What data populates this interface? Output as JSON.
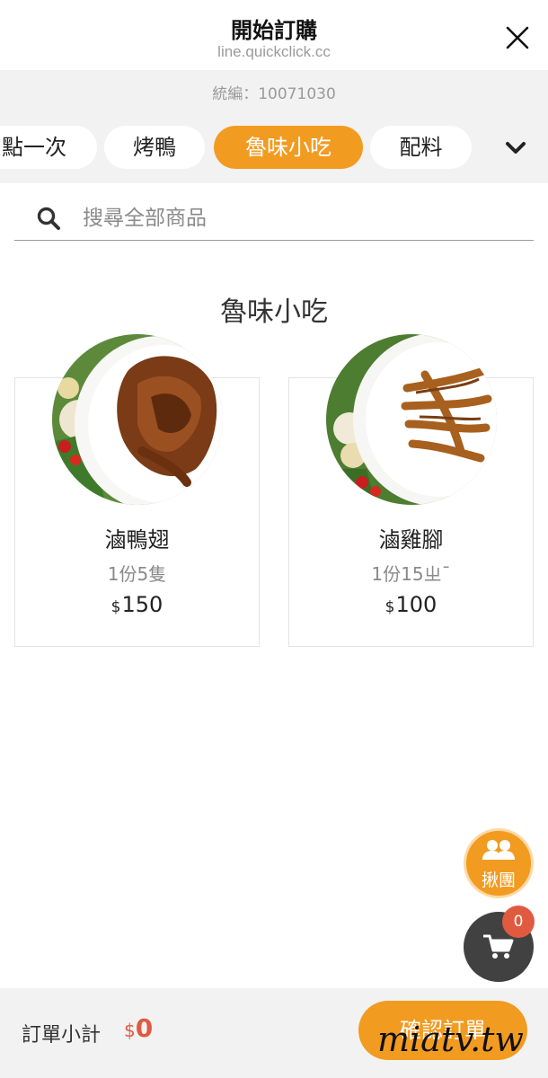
{
  "header": {
    "title": "開始訂購",
    "url": "line.quickclick.cc"
  },
  "store": {
    "tax_id": "統編：10071030"
  },
  "tabs": [
    {
      "label": "點一次",
      "active": false
    },
    {
      "label": "烤鴨",
      "active": false
    },
    {
      "label": "魯味小吃",
      "active": true
    },
    {
      "label": "配料",
      "active": false
    }
  ],
  "search": {
    "placeholder": "搜尋全部商品",
    "value": ""
  },
  "section": {
    "title": "魯味小吃"
  },
  "products": [
    {
      "name": "滷鴨翅",
      "desc": "1份5隻",
      "currency": "$",
      "price": "150"
    },
    {
      "name": "滷雞腳",
      "desc": "1份15ㄓ¯",
      "currency": "$",
      "price": "100"
    }
  ],
  "floating": {
    "group_label": "揪團",
    "cart_count": "0"
  },
  "bottom": {
    "subtotal_label": "訂單小計",
    "subtotal_currency": "$",
    "subtotal_value": "0",
    "confirm_label": "確認訂單"
  },
  "watermark": "miatv.tw",
  "icons": {
    "close": "close-icon",
    "expand": "chevron-down-icon",
    "search": "search-icon",
    "group": "group-icon",
    "cart": "cart-icon"
  },
  "colors": {
    "accent": "#f29b21",
    "price_red": "#e05a3f",
    "band_grey": "#f2f2f2",
    "cart_dark": "#414141"
  }
}
